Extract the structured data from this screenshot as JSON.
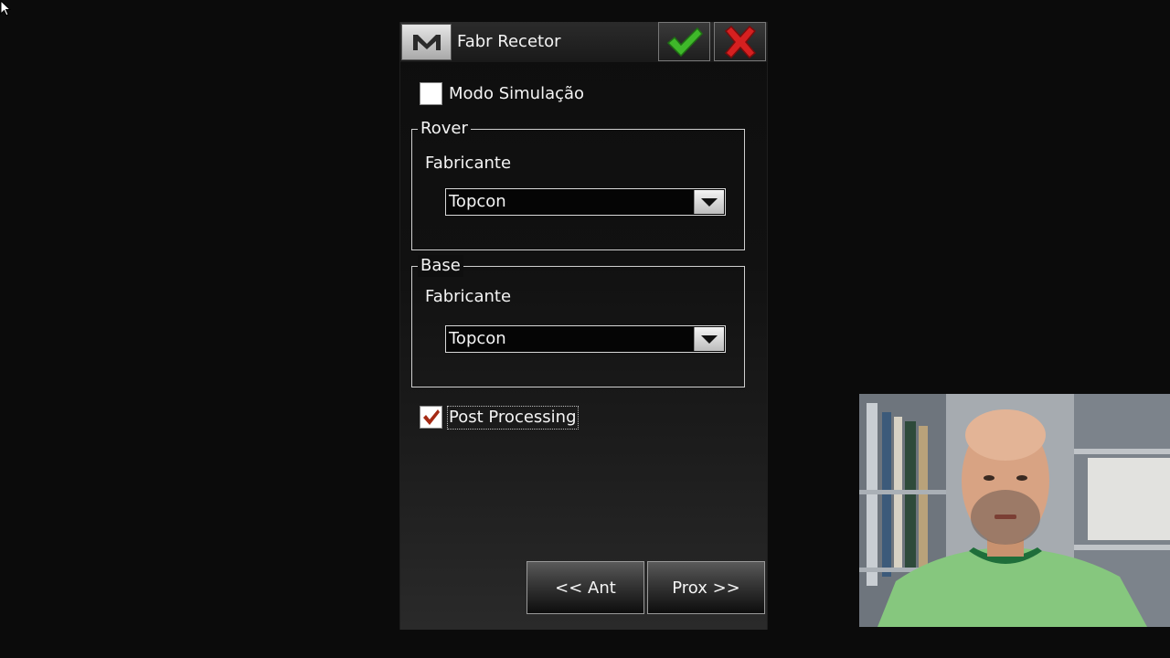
{
  "titlebar": {
    "title": "Fabr Recetor",
    "menu_icon": "m-logo-icon",
    "ok_icon": "check-icon",
    "cancel_icon": "x-icon"
  },
  "simulation": {
    "label": "Modo Simulação",
    "checked": false
  },
  "rover": {
    "legend": "Rover",
    "field_label": "Fabricante",
    "selected": "Topcon"
  },
  "base": {
    "legend": "Base",
    "field_label": "Fabricante",
    "selected": "Topcon"
  },
  "post_processing": {
    "label": "Post Processing",
    "checked": true
  },
  "nav": {
    "prev_label": "<< Ant",
    "next_label": "Prox >>"
  },
  "colors": {
    "check_green": "#3fb82a",
    "cancel_red": "#d62020",
    "checkmark_brown": "#a52a14"
  }
}
